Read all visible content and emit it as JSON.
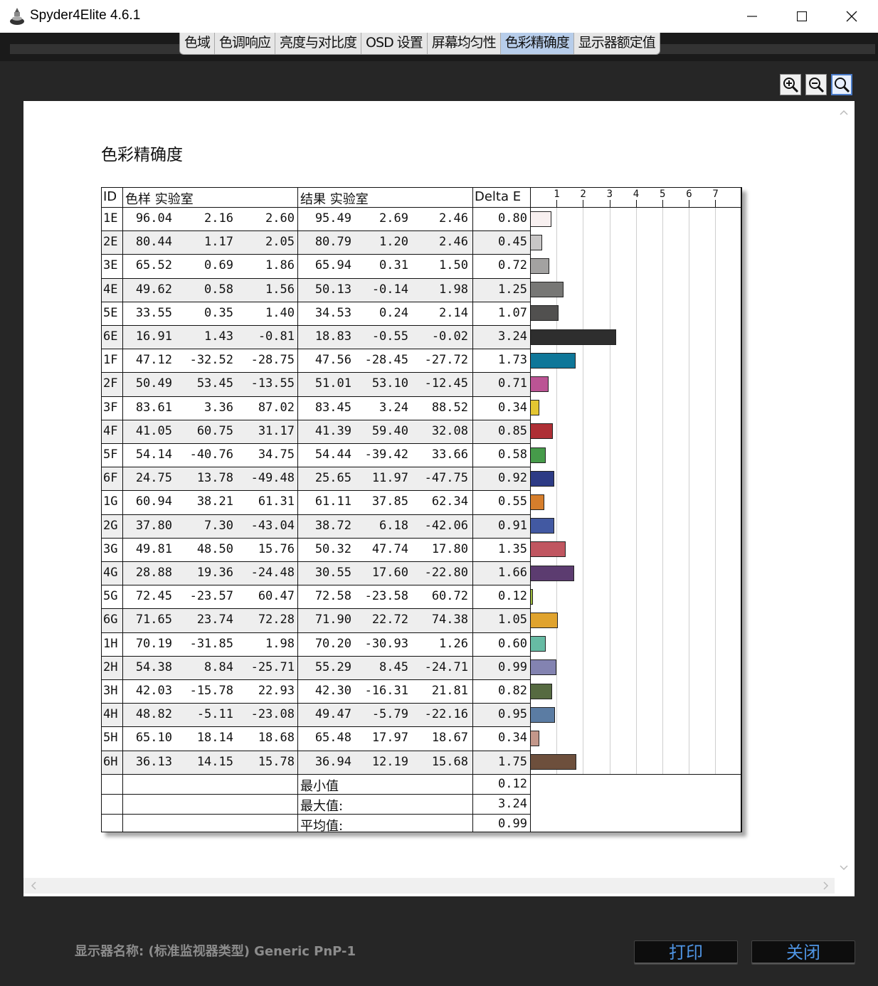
{
  "window": {
    "title": "Spyder4Elite 4.6.1"
  },
  "tabs": [
    {
      "label": "色域"
    },
    {
      "label": "色调响应"
    },
    {
      "label": "亮度与对比度"
    },
    {
      "label": "OSD 设置"
    },
    {
      "label": "屏幕均匀性"
    },
    {
      "label": "色彩精确度",
      "active": true
    },
    {
      "label": "显示器额定值"
    }
  ],
  "zoom_tools": [
    {
      "name": "zoom-in-icon"
    },
    {
      "name": "zoom-out-icon"
    },
    {
      "name": "zoom-fit-icon",
      "active": true
    }
  ],
  "report": {
    "title": "色彩精确度",
    "headers": {
      "id": "ID",
      "sample": "色样 实验室",
      "result": "结果 实验室",
      "delta": "Delta E"
    },
    "summary": [
      {
        "label": "最小值",
        "value": "0.12"
      },
      {
        "label": "最大值:",
        "value": "3.24"
      },
      {
        "label": "平均值:",
        "value": "0.99"
      }
    ]
  },
  "chart_data": {
    "type": "table",
    "xaxis_ticks": [
      "1",
      "2",
      "3",
      "4",
      "5",
      "6",
      "7"
    ],
    "xlim": [
      0,
      7.5
    ],
    "rows": [
      {
        "id": "1E",
        "sample": [
          "96.04",
          "2.16",
          "2.60"
        ],
        "result": [
          "95.49",
          "2.69",
          "2.46"
        ],
        "delta": "0.80",
        "color": "#f8f0f0"
      },
      {
        "id": "2E",
        "sample": [
          "80.44",
          "1.17",
          "2.05"
        ],
        "result": [
          "80.79",
          "1.20",
          "2.46"
        ],
        "delta": "0.45",
        "color": "#c8c6c6"
      },
      {
        "id": "3E",
        "sample": [
          "65.52",
          "0.69",
          "1.86"
        ],
        "result": [
          "65.94",
          "0.31",
          "1.50"
        ],
        "delta": "0.72",
        "color": "#a3a2a1"
      },
      {
        "id": "4E",
        "sample": [
          "49.62",
          "0.58",
          "1.56"
        ],
        "result": [
          "50.13",
          "-0.14",
          "1.98"
        ],
        "delta": "1.25",
        "color": "#777775"
      },
      {
        "id": "5E",
        "sample": [
          "33.55",
          "0.35",
          "1.40"
        ],
        "result": [
          "34.53",
          "0.24",
          "2.14"
        ],
        "delta": "1.07",
        "color": "#51504f"
      },
      {
        "id": "6E",
        "sample": [
          "16.91",
          "1.43",
          "-0.81"
        ],
        "result": [
          "18.83",
          "-0.55",
          "-0.02"
        ],
        "delta": "3.24",
        "color": "#2e2e2e"
      },
      {
        "id": "1F",
        "sample": [
          "47.12",
          "-32.52",
          "-28.75"
        ],
        "result": [
          "47.56",
          "-28.45",
          "-27.72"
        ],
        "delta": "1.73",
        "color": "#0f7799"
      },
      {
        "id": "2F",
        "sample": [
          "50.49",
          "53.45",
          "-13.55"
        ],
        "result": [
          "51.01",
          "53.10",
          "-12.45"
        ],
        "delta": "0.71",
        "color": "#bb5494"
      },
      {
        "id": "3F",
        "sample": [
          "83.61",
          "3.36",
          "87.02"
        ],
        "result": [
          "83.45",
          "3.24",
          "88.52"
        ],
        "delta": "0.34",
        "color": "#e4c632"
      },
      {
        "id": "4F",
        "sample": [
          "41.05",
          "60.75",
          "31.17"
        ],
        "result": [
          "41.39",
          "59.40",
          "32.08"
        ],
        "delta": "0.85",
        "color": "#ae2f35"
      },
      {
        "id": "5F",
        "sample": [
          "54.14",
          "-40.76",
          "34.75"
        ],
        "result": [
          "54.44",
          "-39.42",
          "33.66"
        ],
        "delta": "0.58",
        "color": "#469b4a"
      },
      {
        "id": "6F",
        "sample": [
          "24.75",
          "13.78",
          "-49.48"
        ],
        "result": [
          "25.65",
          "11.97",
          "-47.75"
        ],
        "delta": "0.92",
        "color": "#2d3b85"
      },
      {
        "id": "1G",
        "sample": [
          "60.94",
          "38.21",
          "61.31"
        ],
        "result": [
          "61.11",
          "37.85",
          "62.34"
        ],
        "delta": "0.55",
        "color": "#d67e2c"
      },
      {
        "id": "2G",
        "sample": [
          "37.80",
          "7.30",
          "-43.04"
        ],
        "result": [
          "38.72",
          "6.18",
          "-42.06"
        ],
        "delta": "0.91",
        "color": "#4259a2"
      },
      {
        "id": "3G",
        "sample": [
          "49.81",
          "48.50",
          "15.76"
        ],
        "result": [
          "50.32",
          "47.74",
          "17.80"
        ],
        "delta": "1.35",
        "color": "#c05660"
      },
      {
        "id": "4G",
        "sample": [
          "28.88",
          "19.36",
          "-24.48"
        ],
        "result": [
          "30.55",
          "17.60",
          "-22.80"
        ],
        "delta": "1.66",
        "color": "#5c3c70"
      },
      {
        "id": "5G",
        "sample": [
          "72.45",
          "-23.57",
          "60.47"
        ],
        "result": [
          "72.58",
          "-23.58",
          "60.72"
        ],
        "delta": "0.12",
        "color": "#9dbb3e"
      },
      {
        "id": "6G",
        "sample": [
          "71.65",
          "23.74",
          "72.28"
        ],
        "result": [
          "71.90",
          "22.72",
          "74.38"
        ],
        "delta": "1.05",
        "color": "#e0a32e"
      },
      {
        "id": "1H",
        "sample": [
          "70.19",
          "-31.85",
          "1.98"
        ],
        "result": [
          "70.20",
          "-30.93",
          "1.26"
        ],
        "delta": "0.60",
        "color": "#67bba4"
      },
      {
        "id": "2H",
        "sample": [
          "54.38",
          "8.84",
          "-25.71"
        ],
        "result": [
          "55.29",
          "8.45",
          "-24.71"
        ],
        "delta": "0.99",
        "color": "#8383b1"
      },
      {
        "id": "3H",
        "sample": [
          "42.03",
          "-15.78",
          "22.93"
        ],
        "result": [
          "42.30",
          "-16.31",
          "21.81"
        ],
        "delta": "0.82",
        "color": "#566a41"
      },
      {
        "id": "4H",
        "sample": [
          "48.82",
          "-5.11",
          "-23.08"
        ],
        "result": [
          "49.47",
          "-5.79",
          "-22.16"
        ],
        "delta": "0.95",
        "color": "#5b7ca3"
      },
      {
        "id": "5H",
        "sample": [
          "65.10",
          "18.14",
          "18.68"
        ],
        "result": [
          "65.48",
          "17.97",
          "18.67"
        ],
        "delta": "0.34",
        "color": "#c3978a"
      },
      {
        "id": "6H",
        "sample": [
          "36.13",
          "14.15",
          "15.78"
        ],
        "result": [
          "36.94",
          "12.19",
          "15.68"
        ],
        "delta": "1.75",
        "color": "#6d4f3c"
      }
    ]
  },
  "footer": {
    "monitor_name": "显示器名称: (标准监视器类型) Generic PnP-1",
    "print_label": "打印",
    "close_label": "关闭"
  }
}
